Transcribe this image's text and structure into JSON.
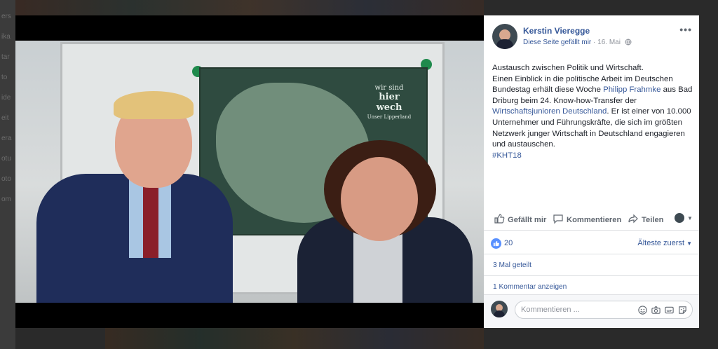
{
  "background": {
    "side_labels": [
      "ers",
      "ika",
      "tar",
      "to",
      "ide",
      "eit",
      "era",
      "otu",
      "oto",
      "om"
    ]
  },
  "post": {
    "author": "Kerstin Vieregge",
    "liked_page_text": "Diese Seite gefällt mir",
    "separator": " · ",
    "date": "16. Mai",
    "text_lines": [
      "Austausch zwischen Politik und Wirtschaft.",
      "Einen Einblick in die politische Arbeit im Deutschen Bundestag erhält diese Woche ",
      "Philipp Frahmke",
      " aus Bad Driburg beim 24. Know-how-Transfer der ",
      "Wirtschaftsjunioren Deutschland",
      ". Er ist einer von 10.000 Unternehmer und Führungskräfte, die sich im größten Netzwerk junger Wirtschaft in Deutschland engagieren und austauschen.",
      "#KHT18"
    ]
  },
  "photo": {
    "map_logo_small": "wir sind",
    "map_logo_big": "hier wech",
    "map_logo_sub": "Unser Lipperland"
  },
  "actions": {
    "like": "Gefällt mir",
    "comment": "Kommentieren",
    "share": "Teilen"
  },
  "reactions": {
    "count": "20",
    "sort": "Älteste zuerst"
  },
  "shares": "3 Mal geteilt",
  "comments_link": "1 Kommentar anzeigen",
  "comment_input": {
    "placeholder": "Kommentieren ..."
  },
  "colors": {
    "link": "#365899",
    "text": "#1d2129",
    "muted": "#90949c",
    "like_blue": "#5890ff"
  }
}
